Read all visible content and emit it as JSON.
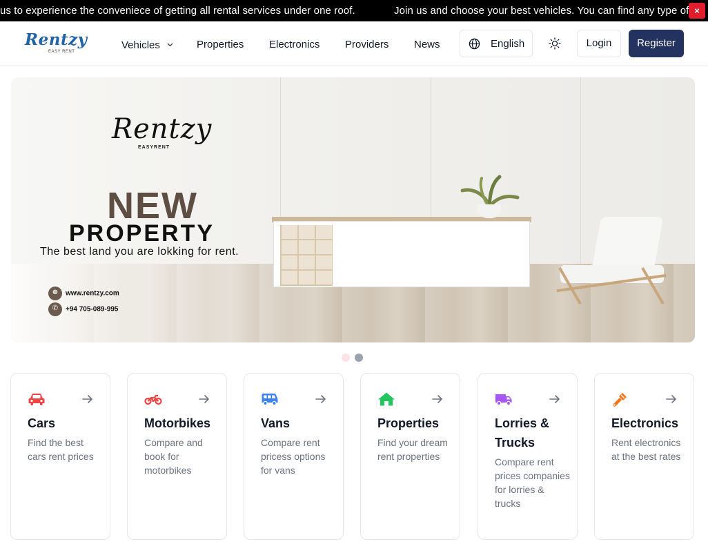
{
  "announcement": {
    "message_left": "us to experience the conveniece of getting all rental services under one roof.",
    "message_right": "Join us and choose your best vehicles. You can find any type of",
    "close_label": "×"
  },
  "header": {
    "logo_text": "Rentzy",
    "logo_tagline": "EASY RENT",
    "nav": {
      "vehicles": "Vehicles",
      "properties": "Properties",
      "electronics": "Electronics",
      "providers": "Providers",
      "news": "News"
    },
    "language": "English",
    "login": "Login",
    "register": "Register"
  },
  "hero": {
    "brand": "Rentzy",
    "brand_sub": "EASYRENT",
    "headline_1": "NEW",
    "headline_2": "PROPERTY",
    "tagline": "The best land you are lokking for rent.",
    "website": "www.rentzy.com",
    "phone": "+94 705-089-995",
    "slides_total": 2,
    "active_slide": 2
  },
  "categories": [
    {
      "title": "Cars",
      "description": "Find the best cars rent prices",
      "icon": "car-icon",
      "color": "#ef4444"
    },
    {
      "title": "Motorbikes",
      "description": "Compare and book for motorbikes",
      "icon": "motorbike-icon",
      "color": "#ef4444"
    },
    {
      "title": "Vans",
      "description": "Compare rent pricess options for vans",
      "icon": "van-icon",
      "color": "#3b82f6"
    },
    {
      "title": "Properties",
      "description": "Find your dream rent properties",
      "icon": "house-icon",
      "color": "#22c55e"
    },
    {
      "title": "Lorries & Trucks",
      "description": "Compare rent prices companies for lorries & trucks",
      "icon": "truck-icon",
      "color": "#a855f7"
    },
    {
      "title": "Electronics",
      "description": "Rent electronics at the best rates",
      "icon": "screwdriver-icon",
      "color": "#f97316"
    }
  ],
  "colors": {
    "primary": "#23325e",
    "announcement_bg": "#000000",
    "close_bg": "#e11d2e"
  }
}
